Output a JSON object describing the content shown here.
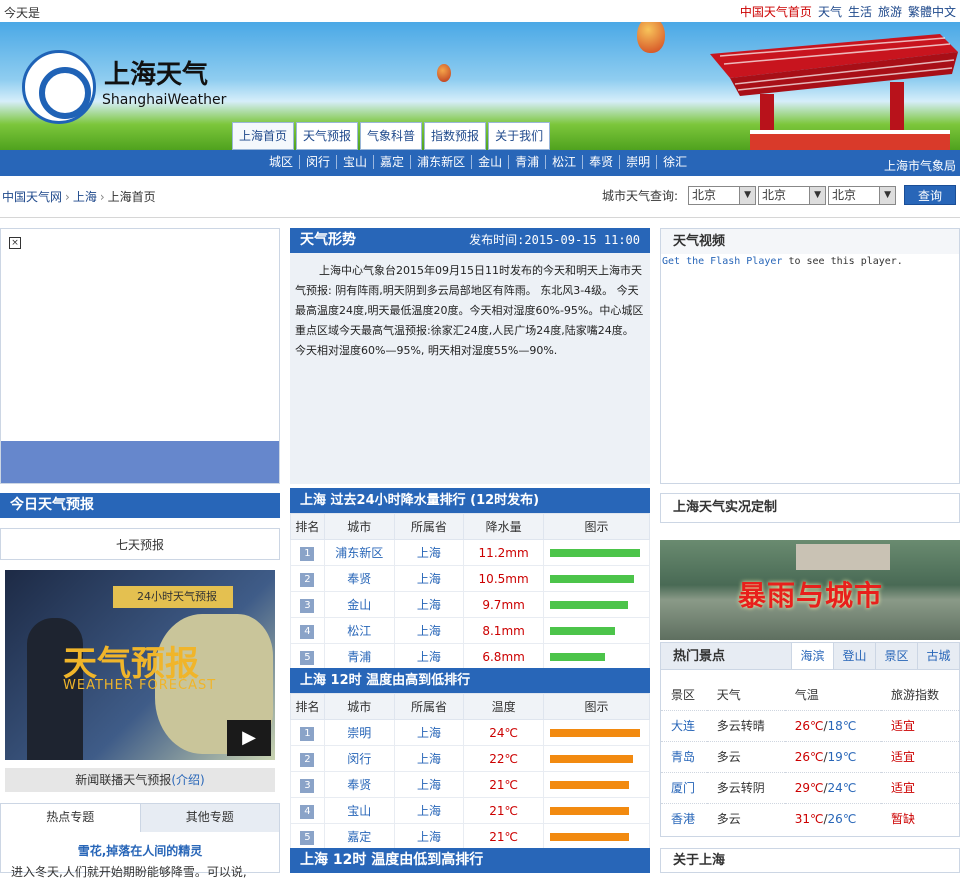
{
  "topbar": {
    "today": "今天是",
    "links": [
      {
        "label": "中国天气首页",
        "red": true
      },
      {
        "label": "天气",
        "red": false
      },
      {
        "label": "生活",
        "red": false
      },
      {
        "label": "旅游",
        "red": false
      },
      {
        "label": "繁體中文",
        "red": false
      }
    ]
  },
  "banner": {
    "title_cn": "上海天气",
    "title_en": "ShanghaiWeather",
    "nav": [
      "上海首页",
      "天气预报",
      "气象科普",
      "指数预报",
      "关于我们"
    ]
  },
  "subnav": {
    "items": [
      "城区",
      "闵行",
      "宝山",
      "嘉定",
      "浦东新区",
      "金山",
      "青浦",
      "松江",
      "奉贤",
      "崇明",
      "徐汇"
    ],
    "bureau": "上海市气象局"
  },
  "breadcrumb": {
    "items": [
      "中国天气网",
      "上海",
      "上海首页"
    ]
  },
  "city_search": {
    "label": "城市天气查询:",
    "selects": [
      "北京",
      "北京",
      "北京"
    ],
    "button": "查询"
  },
  "trend": {
    "title": "天气形势",
    "published": "发布时间:2015-09-15 11:00",
    "text": "上海中心气象台2015年09月15日11时发布的今天和明天上海市天气预报: 阴有阵雨,明天阴到多云局部地区有阵雨。 东北风3-4级。 今天最高温度24度,明天最低温度20度。今天相对湿度60%-95%。中心城区重点区域今天最高气温预报:徐家汇24度,人民广场24度,陆家嘴24度。 今天相对湿度60%—95%, 明天相对湿度55%—90%."
  },
  "video": {
    "title": "天气视频",
    "flash_link": "Get the Flash Player",
    "flash_rest": " to see this player."
  },
  "today_forecast": {
    "title": "今日天气预报",
    "seven_day": "七天预报",
    "tv_badge": "24小时天气预报",
    "tv_cn": "天气预报",
    "tv_en": "WEATHER FORECAST",
    "caption": "新闻联播天气预报",
    "caption_link": "(介绍)"
  },
  "topics": {
    "tabs": [
      "热点专题",
      "其他专题"
    ],
    "title": "雪花,掉落在人间的精灵",
    "desc": "进入冬天,人们就开始期盼能够降雪。可以说,"
  },
  "precip_rank": {
    "title": "上海 过去24小时降水量排行 (12时发布)",
    "headers": [
      "排名",
      "城市",
      "所属省",
      "降水量",
      "图示"
    ],
    "rows": [
      {
        "rank": "1",
        "city": "浦东新区",
        "prov": "上海",
        "value": "11.2mm",
        "level": 11.2
      },
      {
        "rank": "2",
        "city": "奉贤",
        "prov": "上海",
        "value": "10.5mm",
        "level": 10.5
      },
      {
        "rank": "3",
        "city": "金山",
        "prov": "上海",
        "value": "9.7mm",
        "level": 9.7
      },
      {
        "rank": "4",
        "city": "松江",
        "prov": "上海",
        "value": "8.1mm",
        "level": 8.1
      },
      {
        "rank": "5",
        "city": "青浦",
        "prov": "上海",
        "value": "6.8mm",
        "level": 6.8
      }
    ]
  },
  "temp_rank": {
    "title": "上海 12时 温度由高到低排行",
    "headers": [
      "排名",
      "城市",
      "所属省",
      "温度",
      "图示"
    ],
    "rows": [
      {
        "rank": "1",
        "city": "崇明",
        "prov": "上海",
        "value": "24℃",
        "level": 24
      },
      {
        "rank": "2",
        "city": "闵行",
        "prov": "上海",
        "value": "22℃",
        "level": 22
      },
      {
        "rank": "3",
        "city": "奉贤",
        "prov": "上海",
        "value": "21℃",
        "level": 21
      },
      {
        "rank": "4",
        "city": "宝山",
        "prov": "上海",
        "value": "21℃",
        "level": 21
      },
      {
        "rank": "5",
        "city": "嘉定",
        "prov": "上海",
        "value": "21℃",
        "level": 21
      }
    ]
  },
  "temp_rank_low": {
    "title": "上海 12时 温度由低到高排行"
  },
  "custom": {
    "title": "上海天气实况定制"
  },
  "storm": {
    "title": "暴雨与城市"
  },
  "hot_spots": {
    "title": "热门景点",
    "tabs": [
      "海滨",
      "登山",
      "景区",
      "古城"
    ],
    "headers": [
      "景区",
      "天气",
      "气温",
      "旅游指数"
    ],
    "rows": [
      {
        "spot": "大连",
        "weather": "多云转晴",
        "hi": "26℃",
        "lo": "18℃",
        "index": "适宜"
      },
      {
        "spot": "青岛",
        "weather": "多云",
        "hi": "26℃",
        "lo": "19℃",
        "index": "适宜"
      },
      {
        "spot": "厦门",
        "weather": "多云转阴",
        "hi": "29℃",
        "lo": "24℃",
        "index": "适宜"
      },
      {
        "spot": "香港",
        "weather": "多云",
        "hi": "31℃",
        "lo": "26℃",
        "index": "暂缺"
      }
    ]
  },
  "about": {
    "title": "关于上海"
  },
  "colors": {
    "brand_blue": "#2866b8",
    "precip_bar": "#4cc44a",
    "temp_bar": "#f28a10",
    "alert_red": "#cc0000"
  }
}
